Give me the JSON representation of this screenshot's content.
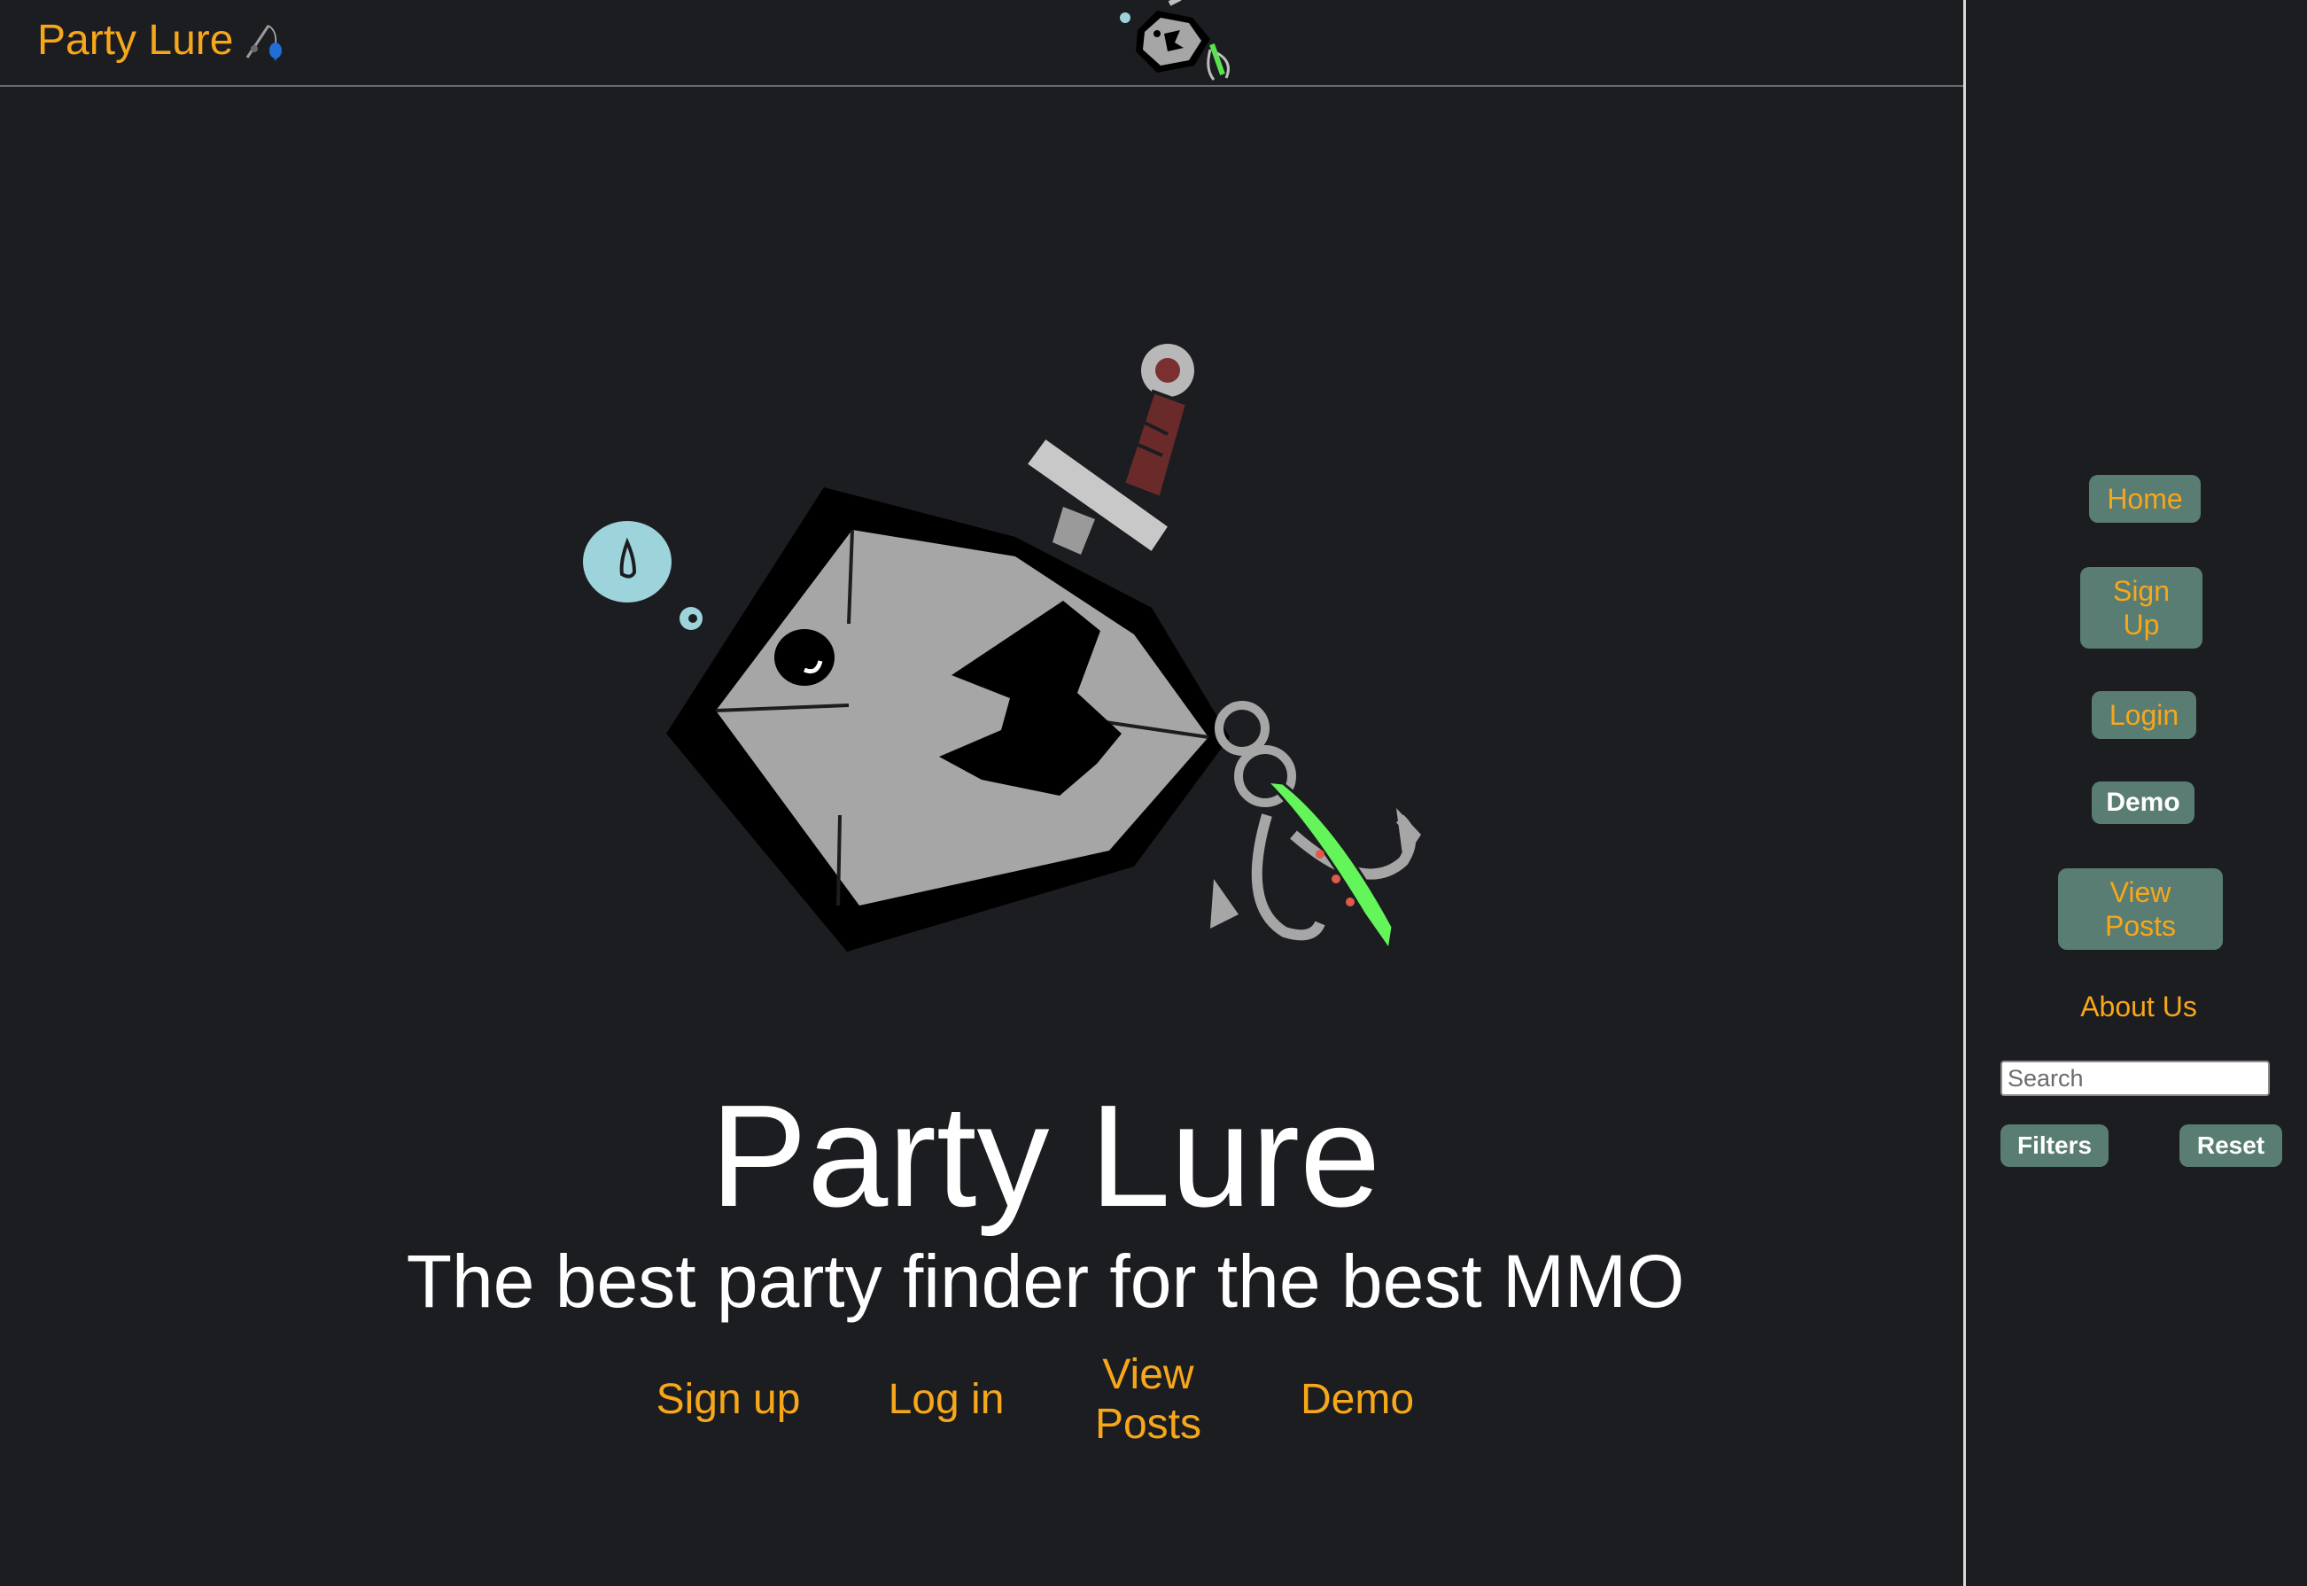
{
  "header": {
    "brand": "Party Lure"
  },
  "hero": {
    "title": "Party Lure",
    "subtitle": "The best party finder for the best MMO",
    "links": {
      "signup": "Sign up",
      "login": "Log in",
      "view_posts": "View Posts",
      "demo": "Demo"
    }
  },
  "sidebar": {
    "home": "Home",
    "signup": "Sign Up",
    "login": "Login",
    "demo": "Demo",
    "view_posts": "View Posts",
    "about": "About Us",
    "search_placeholder": "Search",
    "filters": "Filters",
    "reset": "Reset"
  },
  "colors": {
    "background": "#1c1d21",
    "accent": "#f6a71a",
    "button": "#597d72",
    "text": "#ffffff"
  },
  "icons": [
    "fishing-rod-icon",
    "fish-shield-logo"
  ]
}
